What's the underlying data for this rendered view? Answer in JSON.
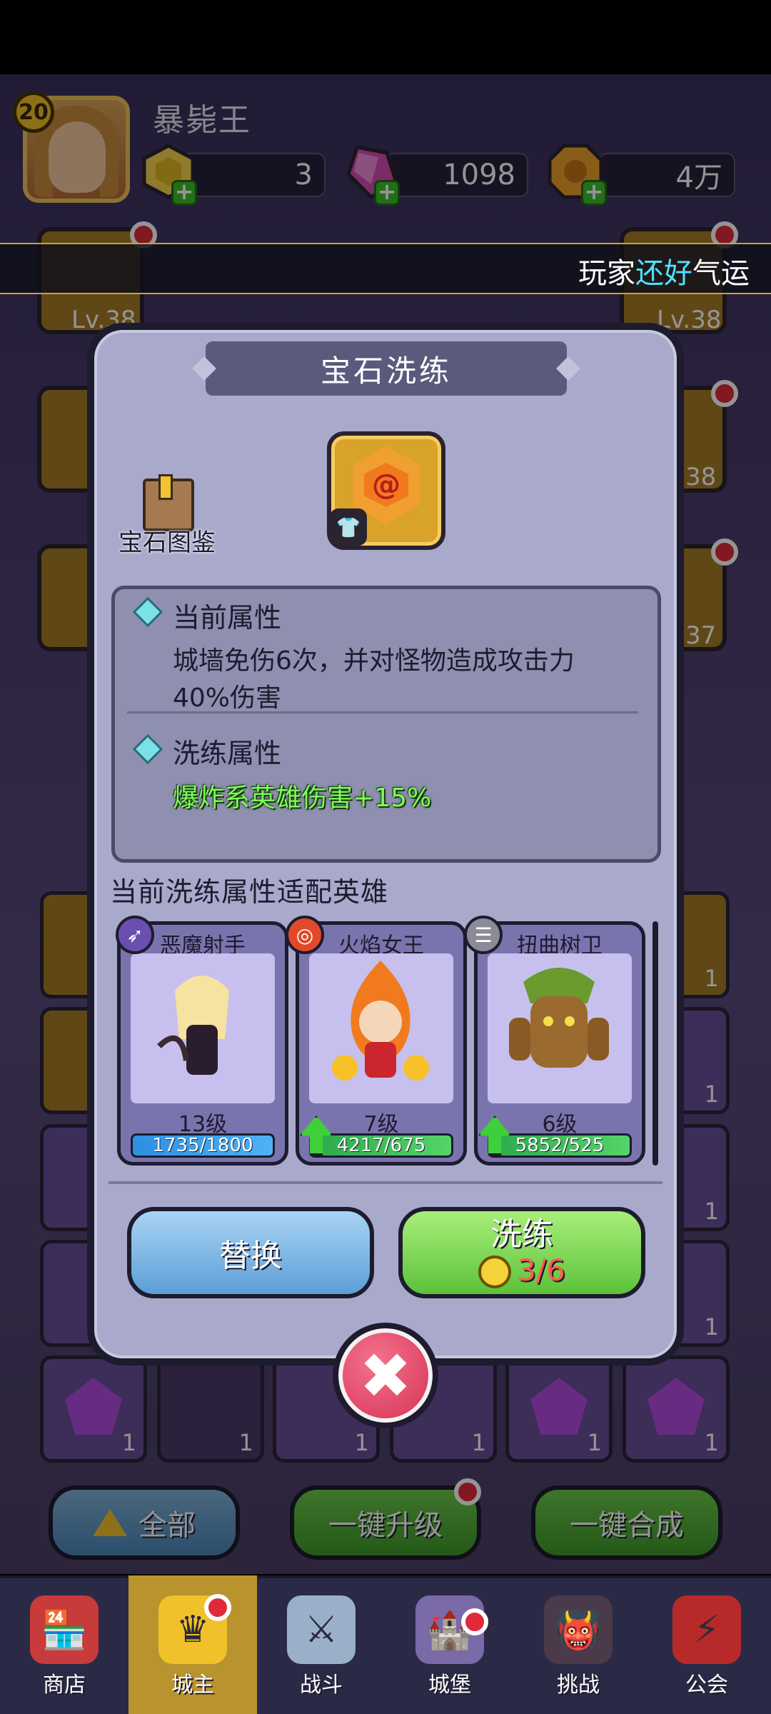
{
  "player": {
    "level": "20",
    "name": "暴毙王"
  },
  "resources": [
    {
      "icon": "gold-gem-icon",
      "value": "3"
    },
    {
      "icon": "crystal-icon",
      "value": "1098"
    },
    {
      "icon": "coin-icon",
      "value": "4万"
    }
  ],
  "ticker": {
    "prefix": "玩家",
    "highlight": "还好",
    "suffix": "气运"
  },
  "side_slots": {
    "left_lv": "Lv.38",
    "right_lv": "Lv.38",
    "right2_lv": "38",
    "right3_lv": "37"
  },
  "modal": {
    "title": "宝石洗练",
    "gem_book_label": "宝石图鉴",
    "current_attr_title": "当前属性",
    "current_attr_text": "城墙免伤6次，并对怪物造成攻击力40%伤害",
    "wash_attr_title": "洗练属性",
    "wash_attr_text": "爆炸系英雄伤害+15%",
    "heroes_title": "当前洗练属性适配英雄",
    "heroes": [
      {
        "name": "恶魔射手",
        "level": "13级",
        "progress": "1735/1800",
        "bar_color": "#2d8fe0",
        "fill": 0.964,
        "upgradable": false,
        "badge_color": "#6a4fb0"
      },
      {
        "name": "火焰女王",
        "level": "7级",
        "progress": "4217/675",
        "bar_color": "#2ba94c",
        "fill": 1.0,
        "upgradable": true,
        "badge_color": "#e04a2a"
      },
      {
        "name": "扭曲树卫",
        "level": "6级",
        "progress": "5852/525",
        "bar_color": "#2ba94c",
        "fill": 1.0,
        "upgradable": true,
        "badge_color": "#8a8a98"
      }
    ],
    "replace_button": "替换",
    "wash_button": "洗练",
    "wash_cost": "3/6"
  },
  "bottom_buttons": {
    "all": "全部",
    "upgrade_all": "一键升级",
    "merge_all": "一键合成"
  },
  "gem_counts": [
    "1",
    "1",
    "1",
    "1",
    "1",
    "1",
    "1",
    "1",
    "1",
    "1",
    "1"
  ],
  "nav": [
    {
      "label": "商店",
      "icon": "shop-icon",
      "active": false
    },
    {
      "label": "城主",
      "icon": "crown-icon",
      "active": true
    },
    {
      "label": "战斗",
      "icon": "swords-icon",
      "active": false
    },
    {
      "label": "城堡",
      "icon": "castle-icon",
      "active": false
    },
    {
      "label": "挑战",
      "icon": "demon-icon",
      "active": false
    },
    {
      "label": "公会",
      "icon": "banner-icon",
      "active": false
    }
  ]
}
